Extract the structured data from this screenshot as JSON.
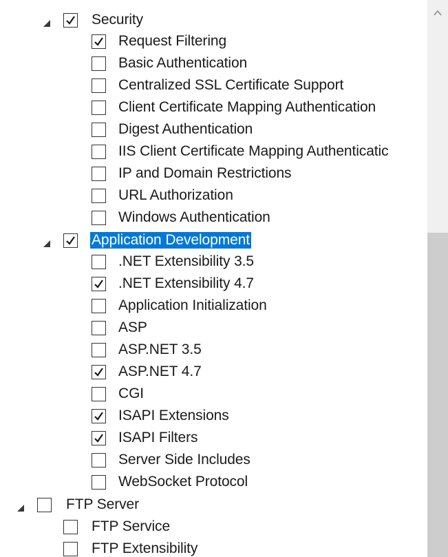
{
  "tree": {
    "security": {
      "label": "Security",
      "checked": true,
      "children": [
        {
          "label": "Request Filtering",
          "checked": true
        },
        {
          "label": "Basic Authentication",
          "checked": false
        },
        {
          "label": "Centralized SSL Certificate Support",
          "checked": false
        },
        {
          "label": "Client Certificate Mapping Authentication",
          "checked": false
        },
        {
          "label": "Digest Authentication",
          "checked": false
        },
        {
          "label": "IIS Client Certificate Mapping Authenticatic",
          "checked": false
        },
        {
          "label": "IP and Domain Restrictions",
          "checked": false
        },
        {
          "label": "URL Authorization",
          "checked": false
        },
        {
          "label": "Windows Authentication",
          "checked": false
        }
      ]
    },
    "app_dev": {
      "label": "Application Development",
      "checked": true,
      "selected": true,
      "children": [
        {
          "label": ".NET Extensibility 3.5",
          "checked": false
        },
        {
          "label": ".NET Extensibility 4.7",
          "checked": true
        },
        {
          "label": "Application Initialization",
          "checked": false
        },
        {
          "label": "ASP",
          "checked": false
        },
        {
          "label": "ASP.NET 3.5",
          "checked": false
        },
        {
          "label": "ASP.NET 4.7",
          "checked": true
        },
        {
          "label": "CGI",
          "checked": false
        },
        {
          "label": "ISAPI Extensions",
          "checked": true
        },
        {
          "label": "ISAPI Filters",
          "checked": true
        },
        {
          "label": "Server Side Includes",
          "checked": false
        },
        {
          "label": "WebSocket Protocol",
          "checked": false
        }
      ]
    },
    "ftp": {
      "label": "FTP Server",
      "checked": false,
      "children": [
        {
          "label": "FTP Service",
          "checked": false
        },
        {
          "label": "FTP Extensibility",
          "checked": false
        }
      ]
    }
  },
  "colors": {
    "selection": "#0078d7",
    "scrollbar_track": "#f0f0f0",
    "scrollbar_thumb": "#cdcdcd"
  }
}
